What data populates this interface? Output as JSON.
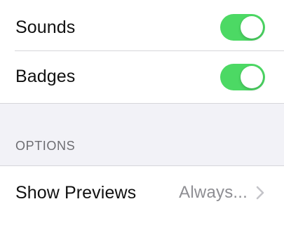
{
  "notifications": {
    "sounds": {
      "label": "Sounds",
      "enabled": true
    },
    "badges": {
      "label": "Badges",
      "enabled": true
    }
  },
  "options_section": {
    "header": "OPTIONS",
    "show_previews": {
      "label": "Show Previews",
      "value": "Always..."
    }
  },
  "colors": {
    "toggle_on": "#4cd964",
    "background": "#f2f2f7",
    "secondary_text": "#8e8e93"
  },
  "icons": {
    "disclosure": "chevron-right-icon"
  }
}
